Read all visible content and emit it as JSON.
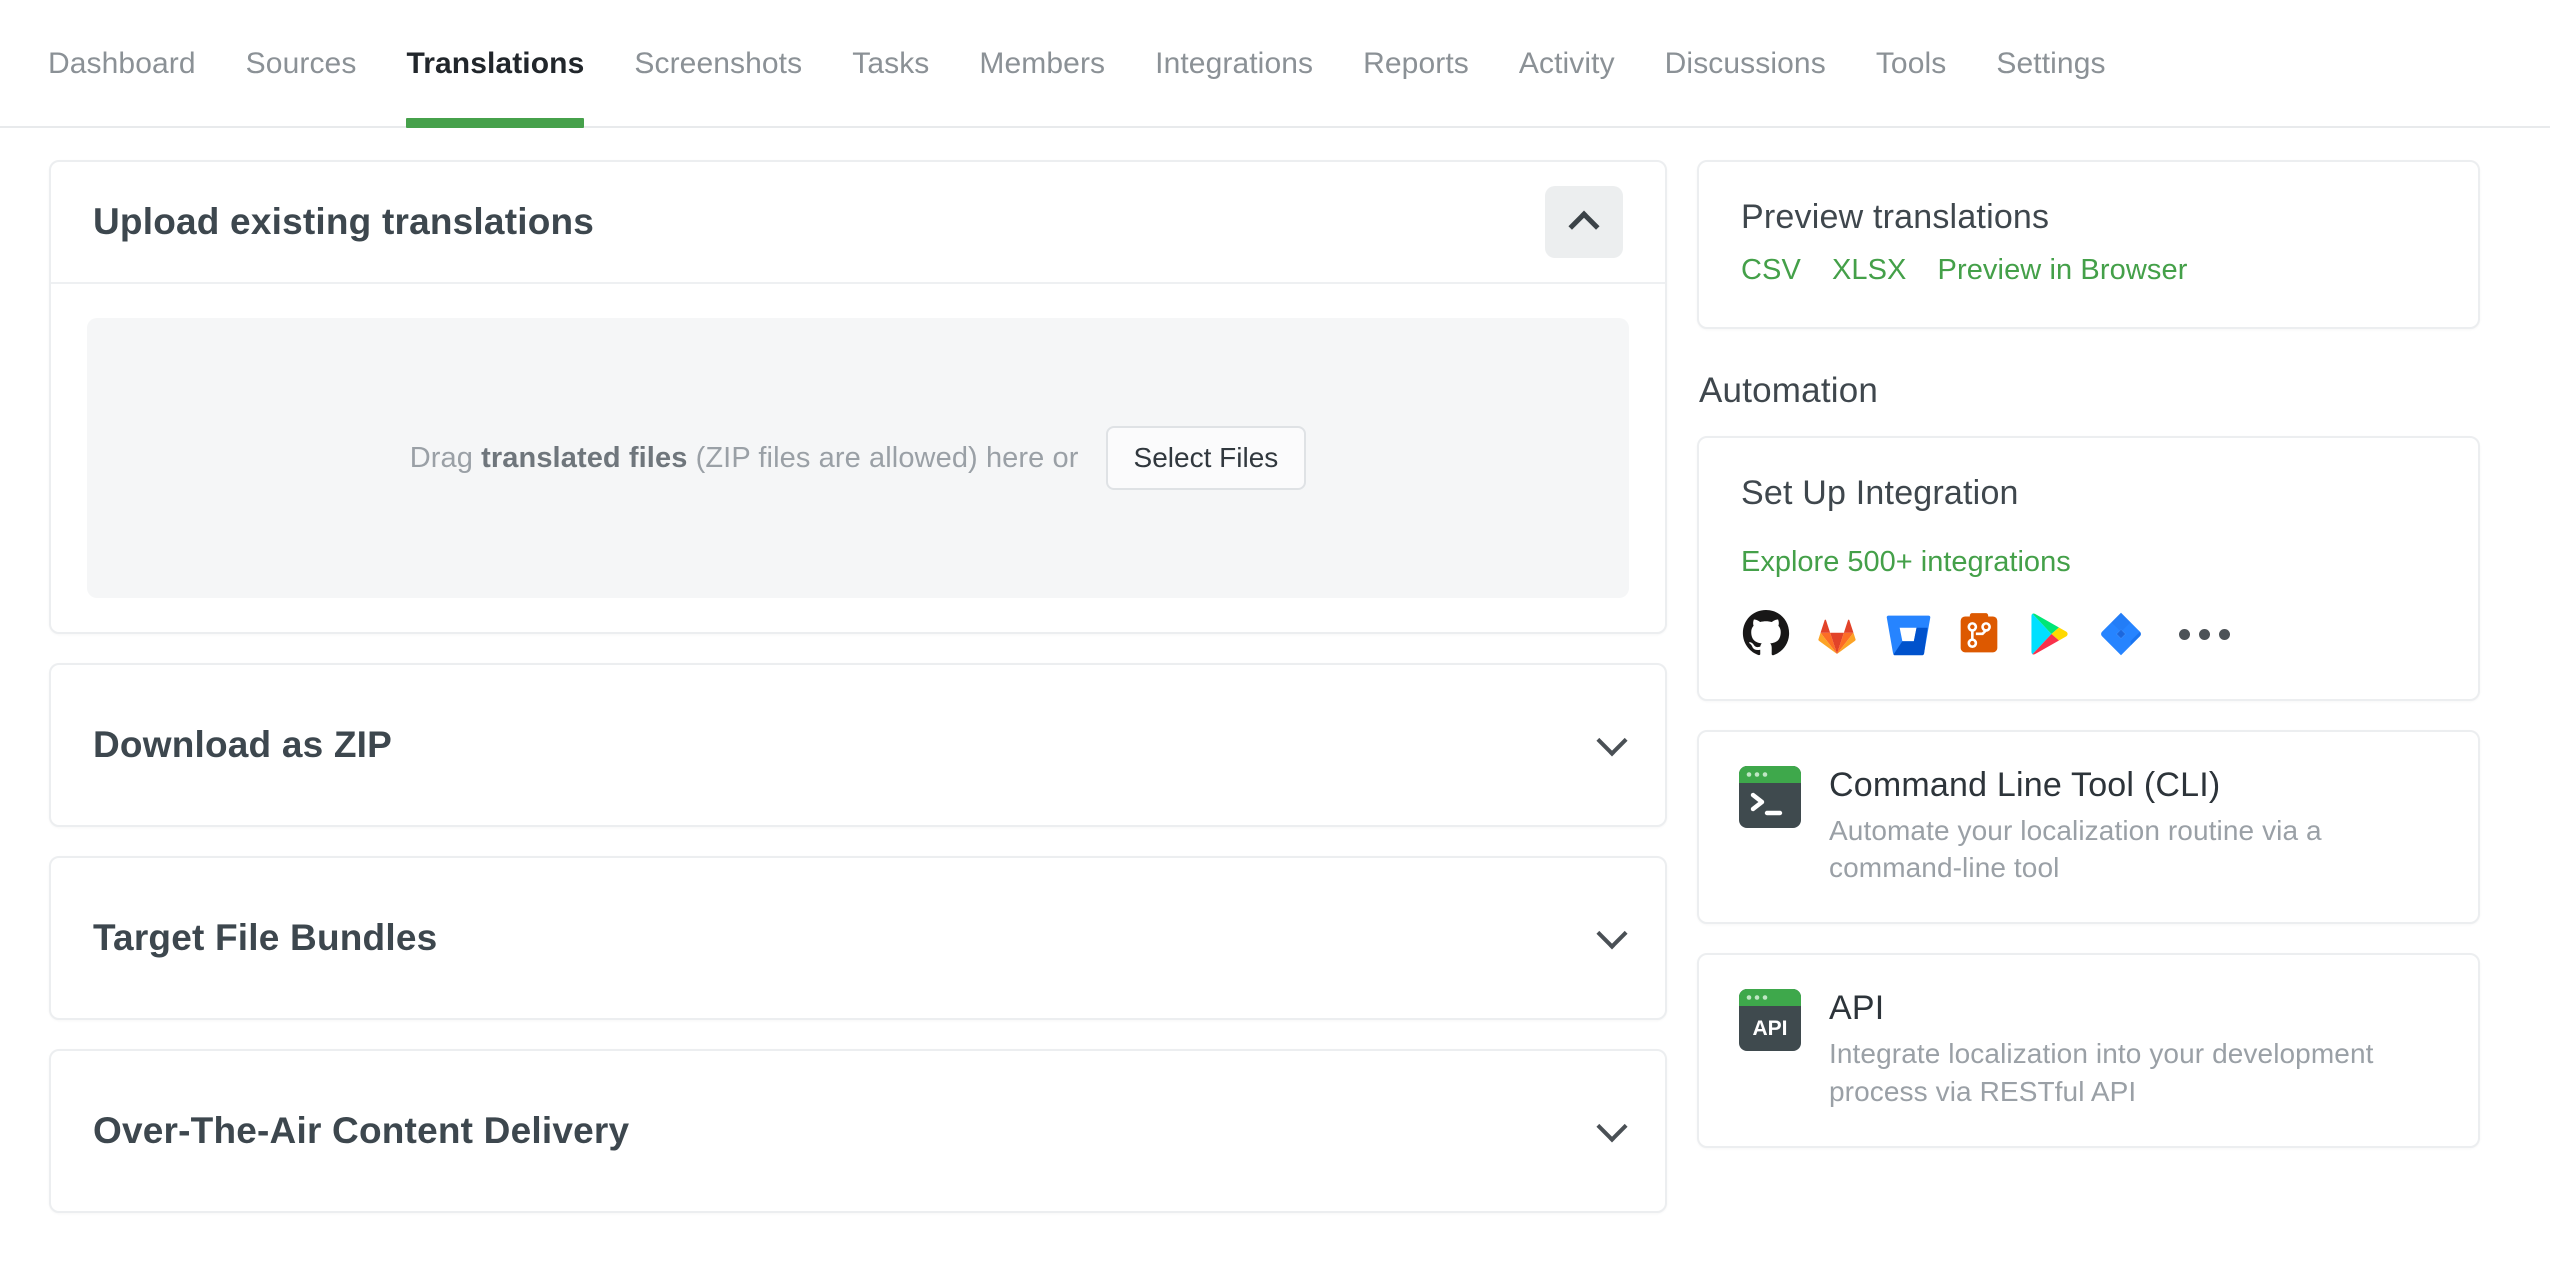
{
  "theme": {
    "accent": "#46a14b",
    "link_green": "#44a049",
    "text_dark": "#3d474e",
    "muted": "#9aa0a6"
  },
  "nav": {
    "items": [
      {
        "label": "Dashboard",
        "active": false
      },
      {
        "label": "Sources",
        "active": false
      },
      {
        "label": "Translations",
        "active": true
      },
      {
        "label": "Screenshots",
        "active": false
      },
      {
        "label": "Tasks",
        "active": false
      },
      {
        "label": "Members",
        "active": false
      },
      {
        "label": "Integrations",
        "active": false
      },
      {
        "label": "Reports",
        "active": false
      },
      {
        "label": "Activity",
        "active": false
      },
      {
        "label": "Discussions",
        "active": false
      },
      {
        "label": "Tools",
        "active": false
      },
      {
        "label": "Settings",
        "active": false
      }
    ]
  },
  "main": {
    "upload": {
      "title": "Upload existing translations",
      "collapse_icon": "chevron-up-icon",
      "dropzone": {
        "text_before": "Drag ",
        "text_strong": "translated files",
        "text_after": " (ZIP files are allowed) here or",
        "button_label": "Select Files"
      }
    },
    "accordions": [
      {
        "title": "Download as ZIP",
        "icon": "chevron-down-icon"
      },
      {
        "title": "Target File Bundles",
        "icon": "chevron-down-icon"
      },
      {
        "title": "Over-The-Air Content Delivery",
        "icon": "chevron-down-icon"
      }
    ]
  },
  "sidebar": {
    "preview": {
      "title": "Preview translations",
      "links": [
        "CSV",
        "XLSX",
        "Preview in Browser"
      ]
    },
    "automation_heading": "Automation",
    "integration": {
      "title": "Set Up Integration",
      "link": "Explore 500+ integrations",
      "icons": [
        "github-icon",
        "gitlab-icon",
        "bitbucket-icon",
        "azure-devops-icon",
        "google-play-icon",
        "jira-icon",
        "more-ellipsis-icon"
      ]
    },
    "tools": [
      {
        "icon": "terminal-window-icon",
        "title": "Command Line Tool (CLI)",
        "desc": "Automate your localization routine via a command-line tool"
      },
      {
        "icon": "api-window-icon",
        "title": "API",
        "desc": "Integrate localization into your development process via RESTful API"
      }
    ]
  }
}
